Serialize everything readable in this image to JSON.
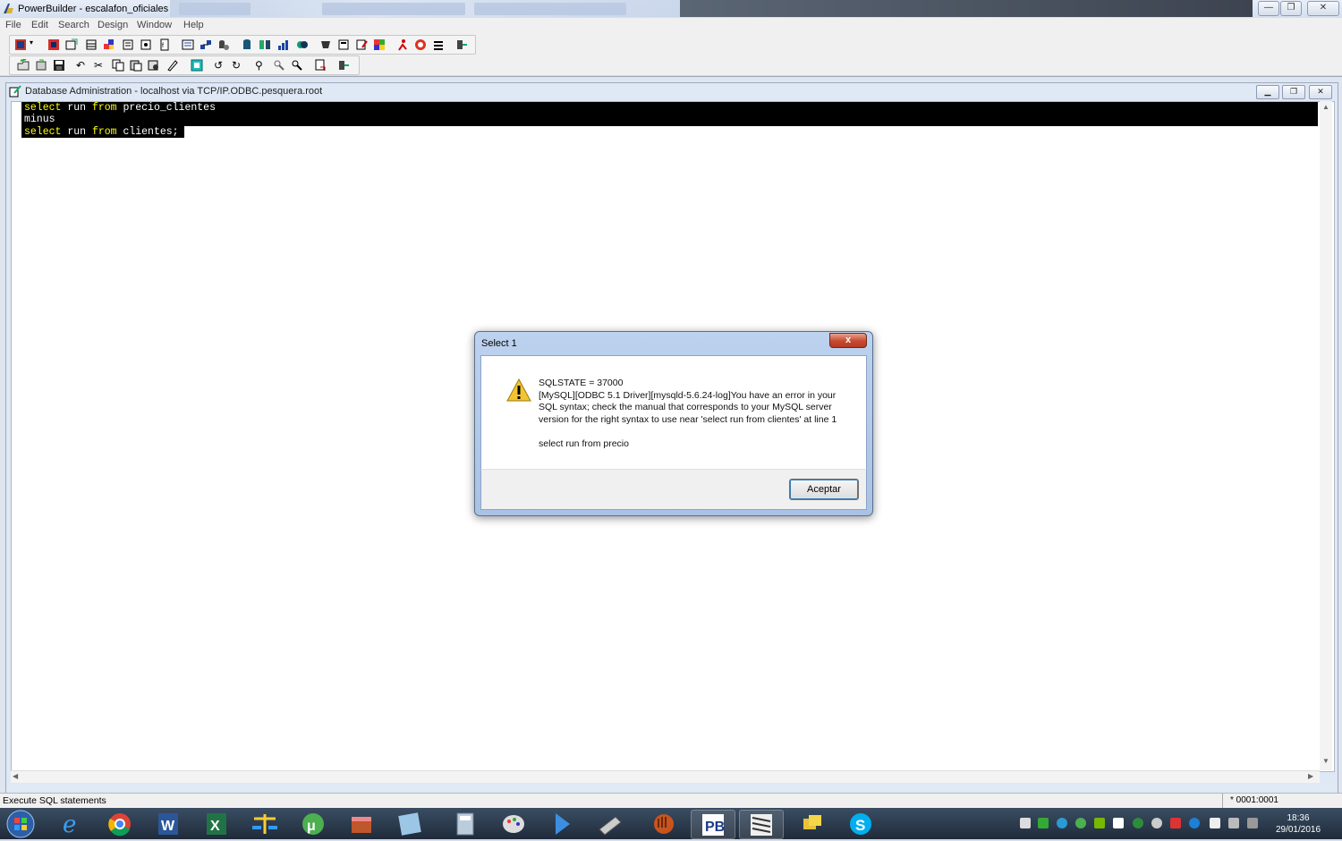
{
  "window": {
    "title": "PowerBuilder - escalafon_oficiales"
  },
  "menu": [
    "File",
    "Edit",
    "Search",
    "Design",
    "Window",
    "Help"
  ],
  "child_window": {
    "title": "Database Administration - localhost via TCP/IP.ODBC.pesquera.root"
  },
  "editor": {
    "lines": [
      {
        "kw1": "select",
        "mid": " run ",
        "kw2": "from",
        "rest": " precio_clientes"
      },
      {
        "kw1": "",
        "mid": "minus",
        "kw2": "",
        "rest": ""
      },
      {
        "kw1": "select",
        "mid": " run ",
        "kw2": "from",
        "rest": " clientes;"
      }
    ]
  },
  "dialog": {
    "title": "Select 1",
    "close_label": "x",
    "lines": [
      "SQLSTATE = 37000",
      "[MySQL][ODBC 5.1 Driver][mysqld-5.6.24-log]You have an error in your",
      "SQL syntax; check the manual that corresponds to your MySQL server",
      "version for the right syntax to use near 'select run from clientes' at line 1",
      "",
      "select run from precio"
    ],
    "ok_label": "Aceptar"
  },
  "status": {
    "text": "Execute SQL statements",
    "position": "* 0001:0001"
  },
  "clock": {
    "time": "18:36",
    "date": "29/01/2016"
  }
}
